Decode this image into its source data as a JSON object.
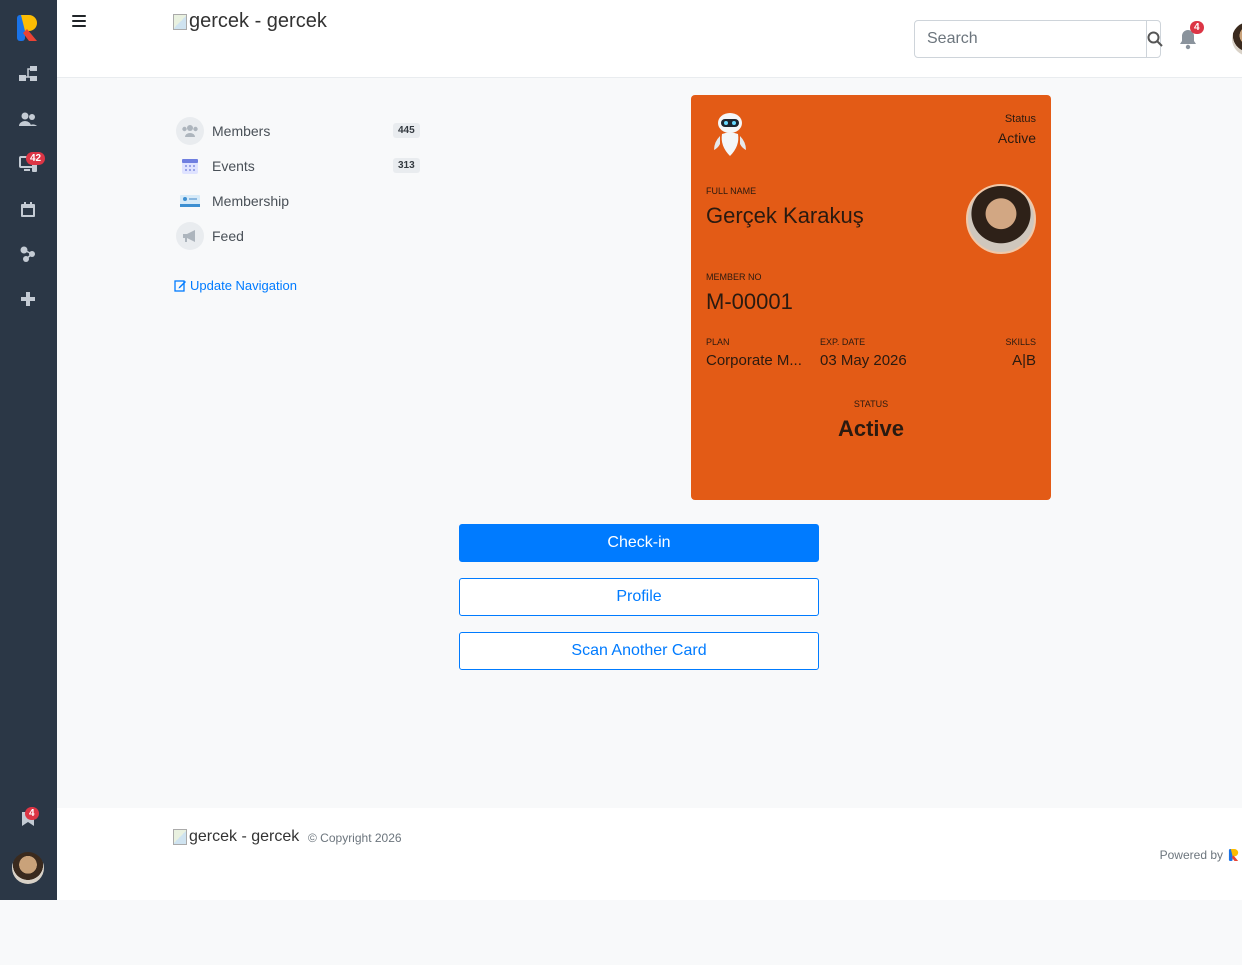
{
  "sidebar": {
    "logo": "r-logo-icon",
    "items": [
      {
        "icon": "hierarchy-icon"
      },
      {
        "icon": "users-icon"
      },
      {
        "icon": "devices-icon",
        "badge": "42"
      },
      {
        "icon": "calendar-icon"
      },
      {
        "icon": "share-icon"
      },
      {
        "icon": "plus-icon"
      }
    ],
    "bottom": {
      "notes_badge": "4"
    }
  },
  "header": {
    "brand": "gercek - gercek",
    "search_placeholder": "Search",
    "notification_count": "4"
  },
  "nav": {
    "items": [
      {
        "label": "Members",
        "count": "445"
      },
      {
        "label": "Events",
        "count": "313"
      },
      {
        "label": "Membership"
      },
      {
        "label": "Feed"
      }
    ],
    "update_label": "Update Navigation"
  },
  "card": {
    "color": "#e35b16",
    "status_label": "Status",
    "status_value": "Active",
    "full_name_label": "FULL NAME",
    "full_name": "Gerçek Karakuş",
    "member_no_label": "MEMBER NO",
    "member_no": "M-00001",
    "plan_label": "PLAN",
    "plan_value": "Corporate M...",
    "exp_label": "EXP. DATE",
    "exp_value": "03 May 2026",
    "skills_label": "SKILLS",
    "skills_value": "A|B",
    "status2_label": "STATUS",
    "status2_value": "Active"
  },
  "actions": {
    "checkin": "Check-in",
    "profile": "Profile",
    "scan": "Scan Another Card"
  },
  "footer": {
    "brand": "gercek - gercek",
    "copyright": "© Copyright 2026",
    "powered": "Powered by"
  }
}
